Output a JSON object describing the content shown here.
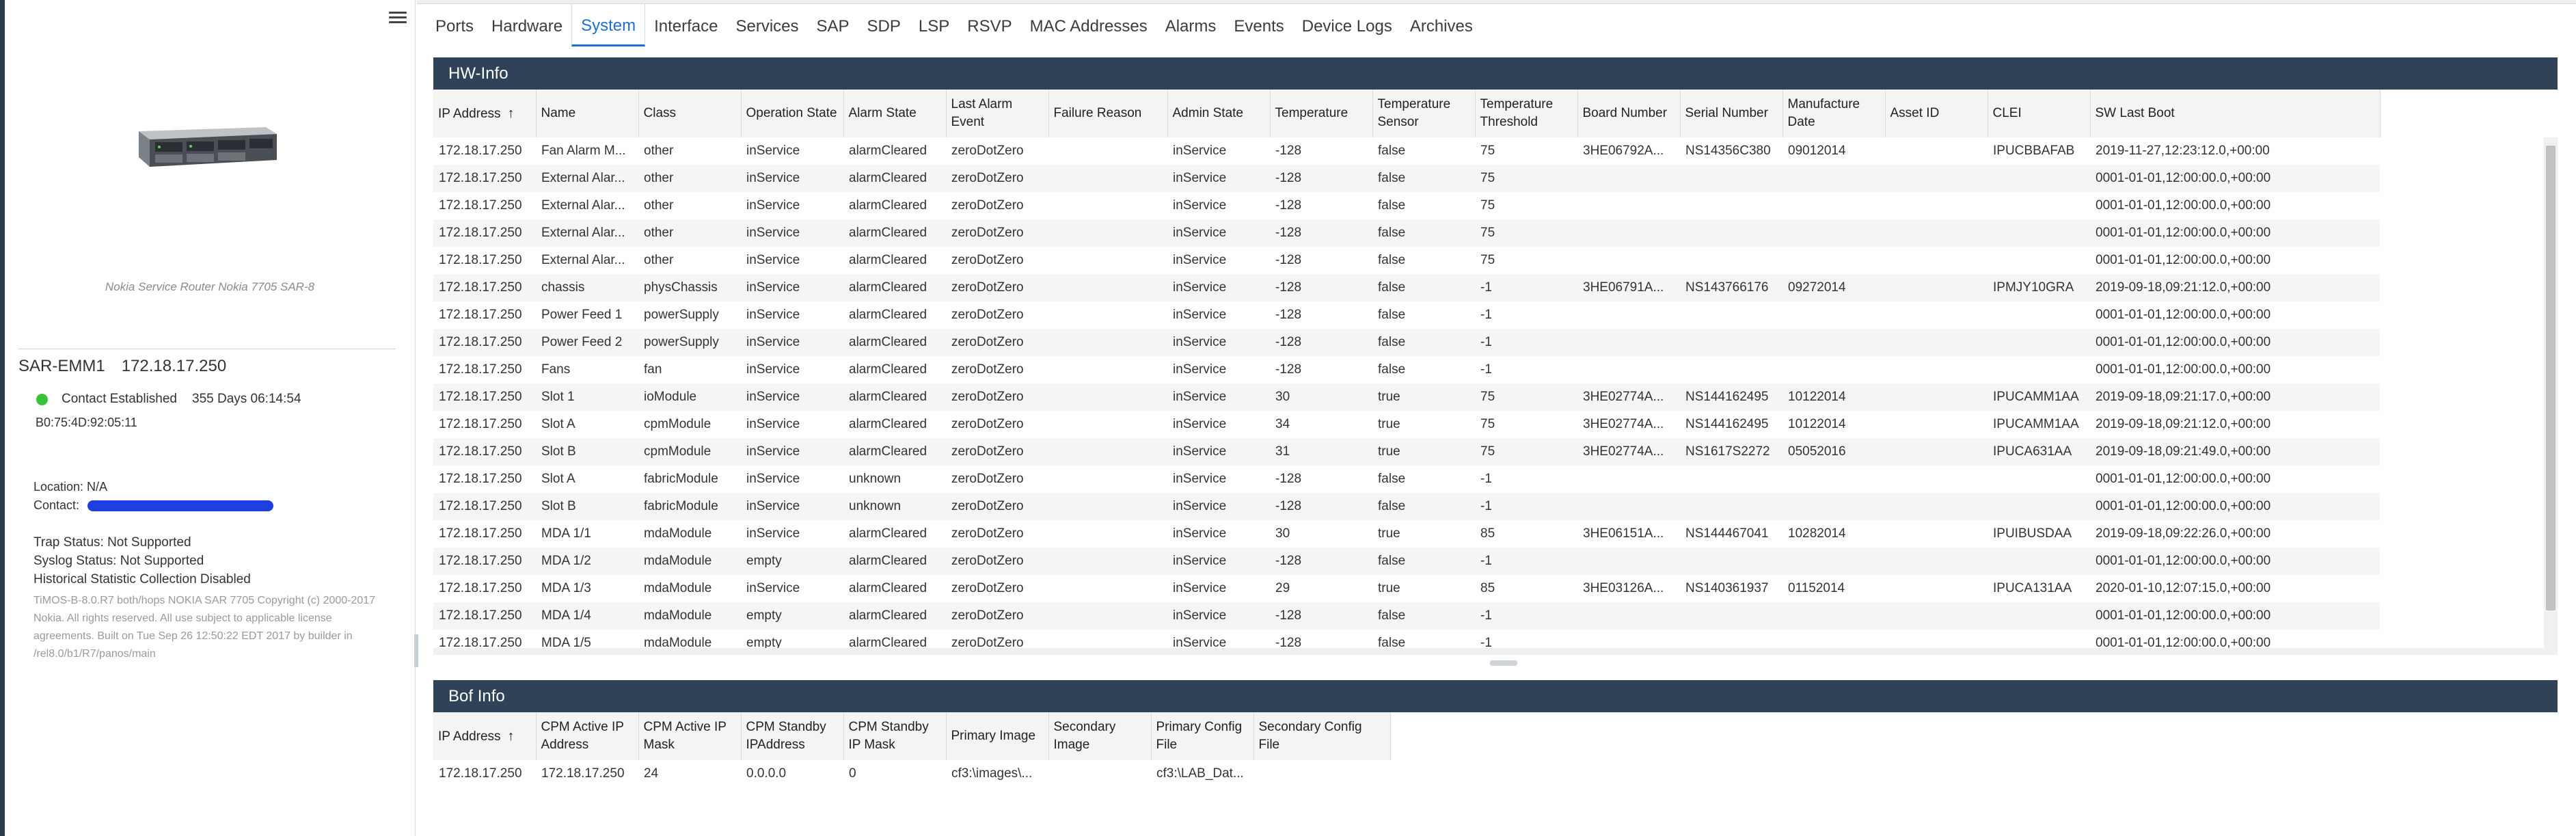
{
  "tabs": [
    "Ports",
    "Hardware",
    "System",
    "Interface",
    "Services",
    "SAP",
    "SDP",
    "LSP",
    "RSVP",
    "MAC Addresses",
    "Alarms",
    "Events",
    "Device Logs",
    "Archives"
  ],
  "active_tab": "System",
  "side": {
    "caption": "Nokia Service Router Nokia 7705 SAR-8",
    "device_name": "SAR-EMM1",
    "device_ip": "172.18.17.250",
    "contact_status": "Contact Established",
    "uptime": "355 Days 06:14:54",
    "mac": "B0:75:4D:92:05:11",
    "location": "Location: N/A",
    "contact_label": "Contact:",
    "trap_status": "Trap Status: Not Supported",
    "syslog_status": "Syslog Status: Not Supported",
    "historical": "Historical Statistic Collection Disabled",
    "legal": "TiMOS-B-8.0.R7 both/hops NOKIA SAR 7705 Copyright (c) 2000-2017 Nokia. All rights reserved. All use subject to applicable license agreements. Built on Tue Sep 26 12:50:22 EDT 2017 by builder in /rel8.0/b1/R7/panos/main"
  },
  "hw": {
    "title": "HW-Info",
    "columns": [
      "IP Address",
      "Name",
      "Class",
      "Operation State",
      "Alarm State",
      "Last Alarm Event",
      "Failure Reason",
      "Admin State",
      "Temperature",
      "Temperature Sensor",
      "Temperature Threshold",
      "Board Number",
      "Serial Number",
      "Manufacture Date",
      "Asset ID",
      "CLEI",
      "SW Last Boot"
    ],
    "rows": [
      [
        "172.18.17.250",
        "Fan Alarm M...",
        "other",
        "inService",
        "alarmCleared",
        "zeroDotZero",
        "",
        "inService",
        "-128",
        "false",
        "75",
        "3HE06792A...",
        "NS14356C380",
        "09012014",
        "",
        "IPUCBBAFAB",
        "2019-11-27,12:23:12.0,+00:00"
      ],
      [
        "172.18.17.250",
        "External Alar...",
        "other",
        "inService",
        "alarmCleared",
        "zeroDotZero",
        "",
        "inService",
        "-128",
        "false",
        "75",
        "",
        "",
        "",
        "",
        "",
        "0001-01-01,12:00:00.0,+00:00"
      ],
      [
        "172.18.17.250",
        "External Alar...",
        "other",
        "inService",
        "alarmCleared",
        "zeroDotZero",
        "",
        "inService",
        "-128",
        "false",
        "75",
        "",
        "",
        "",
        "",
        "",
        "0001-01-01,12:00:00.0,+00:00"
      ],
      [
        "172.18.17.250",
        "External Alar...",
        "other",
        "inService",
        "alarmCleared",
        "zeroDotZero",
        "",
        "inService",
        "-128",
        "false",
        "75",
        "",
        "",
        "",
        "",
        "",
        "0001-01-01,12:00:00.0,+00:00"
      ],
      [
        "172.18.17.250",
        "External Alar...",
        "other",
        "inService",
        "alarmCleared",
        "zeroDotZero",
        "",
        "inService",
        "-128",
        "false",
        "75",
        "",
        "",
        "",
        "",
        "",
        "0001-01-01,12:00:00.0,+00:00"
      ],
      [
        "172.18.17.250",
        "chassis",
        "physChassis",
        "inService",
        "alarmCleared",
        "zeroDotZero",
        "",
        "inService",
        "-128",
        "false",
        "-1",
        "3HE06791A...",
        "NS143766176",
        "09272014",
        "",
        "IPMJY10GRA",
        "2019-09-18,09:21:12.0,+00:00"
      ],
      [
        "172.18.17.250",
        "Power Feed 1",
        "powerSupply",
        "inService",
        "alarmCleared",
        "zeroDotZero",
        "",
        "inService",
        "-128",
        "false",
        "-1",
        "",
        "",
        "",
        "",
        "",
        "0001-01-01,12:00:00.0,+00:00"
      ],
      [
        "172.18.17.250",
        "Power Feed 2",
        "powerSupply",
        "inService",
        "alarmCleared",
        "zeroDotZero",
        "",
        "inService",
        "-128",
        "false",
        "-1",
        "",
        "",
        "",
        "",
        "",
        "0001-01-01,12:00:00.0,+00:00"
      ],
      [
        "172.18.17.250",
        "Fans",
        "fan",
        "inService",
        "alarmCleared",
        "zeroDotZero",
        "",
        "inService",
        "-128",
        "false",
        "-1",
        "",
        "",
        "",
        "",
        "",
        "0001-01-01,12:00:00.0,+00:00"
      ],
      [
        "172.18.17.250",
        "Slot 1",
        "ioModule",
        "inService",
        "alarmCleared",
        "zeroDotZero",
        "",
        "inService",
        "30",
        "true",
        "75",
        "3HE02774A...",
        "NS144162495",
        "10122014",
        "",
        "IPUCAMM1AA",
        "2019-09-18,09:21:17.0,+00:00"
      ],
      [
        "172.18.17.250",
        "Slot A",
        "cpmModule",
        "inService",
        "alarmCleared",
        "zeroDotZero",
        "",
        "inService",
        "34",
        "true",
        "75",
        "3HE02774A...",
        "NS144162495",
        "10122014",
        "",
        "IPUCAMM1AA",
        "2019-09-18,09:21:12.0,+00:00"
      ],
      [
        "172.18.17.250",
        "Slot B",
        "cpmModule",
        "inService",
        "alarmCleared",
        "zeroDotZero",
        "",
        "inService",
        "31",
        "true",
        "75",
        "3HE02774A...",
        "NS1617S2272",
        "05052016",
        "",
        "IPUCA631AA",
        "2019-09-18,09:21:49.0,+00:00"
      ],
      [
        "172.18.17.250",
        "Slot A",
        "fabricModule",
        "inService",
        "unknown",
        "zeroDotZero",
        "",
        "inService",
        "-128",
        "false",
        "-1",
        "",
        "",
        "",
        "",
        "",
        "0001-01-01,12:00:00.0,+00:00"
      ],
      [
        "172.18.17.250",
        "Slot B",
        "fabricModule",
        "inService",
        "unknown",
        "zeroDotZero",
        "",
        "inService",
        "-128",
        "false",
        "-1",
        "",
        "",
        "",
        "",
        "",
        "0001-01-01,12:00:00.0,+00:00"
      ],
      [
        "172.18.17.250",
        "MDA 1/1",
        "mdaModule",
        "inService",
        "alarmCleared",
        "zeroDotZero",
        "",
        "inService",
        "30",
        "true",
        "85",
        "3HE06151A...",
        "NS144467041",
        "10282014",
        "",
        "IPUIBUSDAA",
        "2019-09-18,09:22:26.0,+00:00"
      ],
      [
        "172.18.17.250",
        "MDA 1/2",
        "mdaModule",
        "empty",
        "alarmCleared",
        "zeroDotZero",
        "",
        "inService",
        "-128",
        "false",
        "-1",
        "",
        "",
        "",
        "",
        "",
        "0001-01-01,12:00:00.0,+00:00"
      ],
      [
        "172.18.17.250",
        "MDA 1/3",
        "mdaModule",
        "inService",
        "alarmCleared",
        "zeroDotZero",
        "",
        "inService",
        "29",
        "true",
        "85",
        "3HE03126A...",
        "NS140361937",
        "01152014",
        "",
        "IPUCA131AA",
        "2020-01-10,12:07:15.0,+00:00"
      ],
      [
        "172.18.17.250",
        "MDA 1/4",
        "mdaModule",
        "empty",
        "alarmCleared",
        "zeroDotZero",
        "",
        "inService",
        "-128",
        "false",
        "-1",
        "",
        "",
        "",
        "",
        "",
        "0001-01-01,12:00:00.0,+00:00"
      ],
      [
        "172.18.17.250",
        "MDA 1/5",
        "mdaModule",
        "empty",
        "alarmCleared",
        "zeroDotZero",
        "",
        "inService",
        "-128",
        "false",
        "-1",
        "",
        "",
        "",
        "",
        "",
        "0001-01-01,12:00:00.0,+00:00"
      ]
    ]
  },
  "bof": {
    "title": "Bof Info",
    "columns": [
      "IP Address",
      "CPM Active IP Address",
      "CPM Active IP Mask",
      "CPM Standby IPAddress",
      "CPM Standby IP Mask",
      "Primary Image",
      "Secondary Image",
      "Primary Config File",
      "Secondary Config File"
    ],
    "rows": [
      [
        "172.18.17.250",
        "172.18.17.250",
        "24",
        "0.0.0.0",
        "0",
        "cf3:\\images\\...",
        "",
        "cf3:\\LAB_Dat...",
        ""
      ]
    ]
  },
  "colors": {
    "header_bg": "#304257",
    "accent": "#1f6fd1",
    "status_ok": "#39c239",
    "redaction": "#1f3fe0"
  }
}
